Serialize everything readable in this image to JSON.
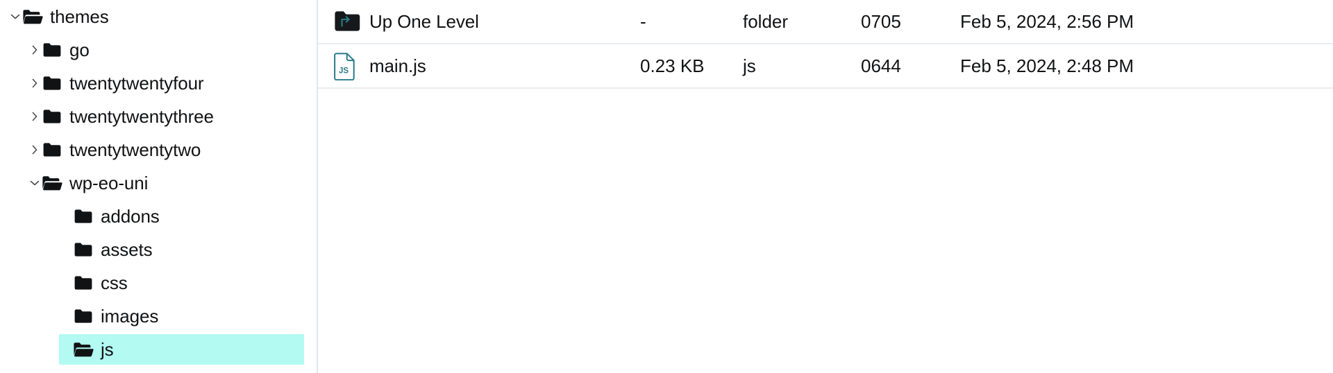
{
  "sidebar": {
    "name": "file-tree",
    "selected_path": "themes/wp-eo-uni/js",
    "highlight_color": "#b2faf2",
    "items": [
      {
        "label": "themes",
        "level": 0,
        "expanded": true,
        "has_children": true,
        "icon": "folder-open-icon",
        "chevron": "chevron-down-icon",
        "selected": false
      },
      {
        "label": "go",
        "level": 1,
        "expanded": false,
        "has_children": true,
        "icon": "folder-closed-icon",
        "chevron": "chevron-right-icon",
        "selected": false
      },
      {
        "label": "twentytwentyfour",
        "level": 1,
        "expanded": false,
        "has_children": true,
        "icon": "folder-closed-icon",
        "chevron": "chevron-right-icon",
        "selected": false
      },
      {
        "label": "twentytwentythree",
        "level": 1,
        "expanded": false,
        "has_children": true,
        "icon": "folder-closed-icon",
        "chevron": "chevron-right-icon",
        "selected": false
      },
      {
        "label": "twentytwentytwo",
        "level": 1,
        "expanded": false,
        "has_children": true,
        "icon": "folder-closed-icon",
        "chevron": "chevron-right-icon",
        "selected": false
      },
      {
        "label": "wp-eo-uni",
        "level": 1,
        "expanded": true,
        "has_children": true,
        "icon": "folder-open-icon",
        "chevron": "chevron-down-icon",
        "selected": false
      },
      {
        "label": "addons",
        "level": 2,
        "expanded": false,
        "has_children": false,
        "icon": "folder-closed-icon",
        "chevron": "none",
        "selected": false
      },
      {
        "label": "assets",
        "level": 2,
        "expanded": false,
        "has_children": false,
        "icon": "folder-closed-icon",
        "chevron": "none",
        "selected": false
      },
      {
        "label": "css",
        "level": 2,
        "expanded": false,
        "has_children": false,
        "icon": "folder-closed-icon",
        "chevron": "none",
        "selected": false
      },
      {
        "label": "images",
        "level": 2,
        "expanded": false,
        "has_children": false,
        "icon": "folder-closed-icon",
        "chevron": "none",
        "selected": false
      },
      {
        "label": "js",
        "level": 2,
        "expanded": true,
        "has_children": false,
        "icon": "folder-open-icon",
        "chevron": "none",
        "selected": true
      }
    ]
  },
  "filelist": {
    "name": "directory-contents",
    "accent_color": "#2a7b87",
    "rows": [
      {
        "name": "Up One Level",
        "size": "-",
        "type": "folder",
        "permissions": "0705",
        "modified": "Feb 5, 2024, 2:56 PM",
        "icon": "folder-up-one-level-icon"
      },
      {
        "name": "main.js",
        "size": "0.23 KB",
        "type": "js",
        "permissions": "0644",
        "modified": "Feb 5, 2024, 2:48 PM",
        "icon": "js-file-icon"
      }
    ]
  }
}
